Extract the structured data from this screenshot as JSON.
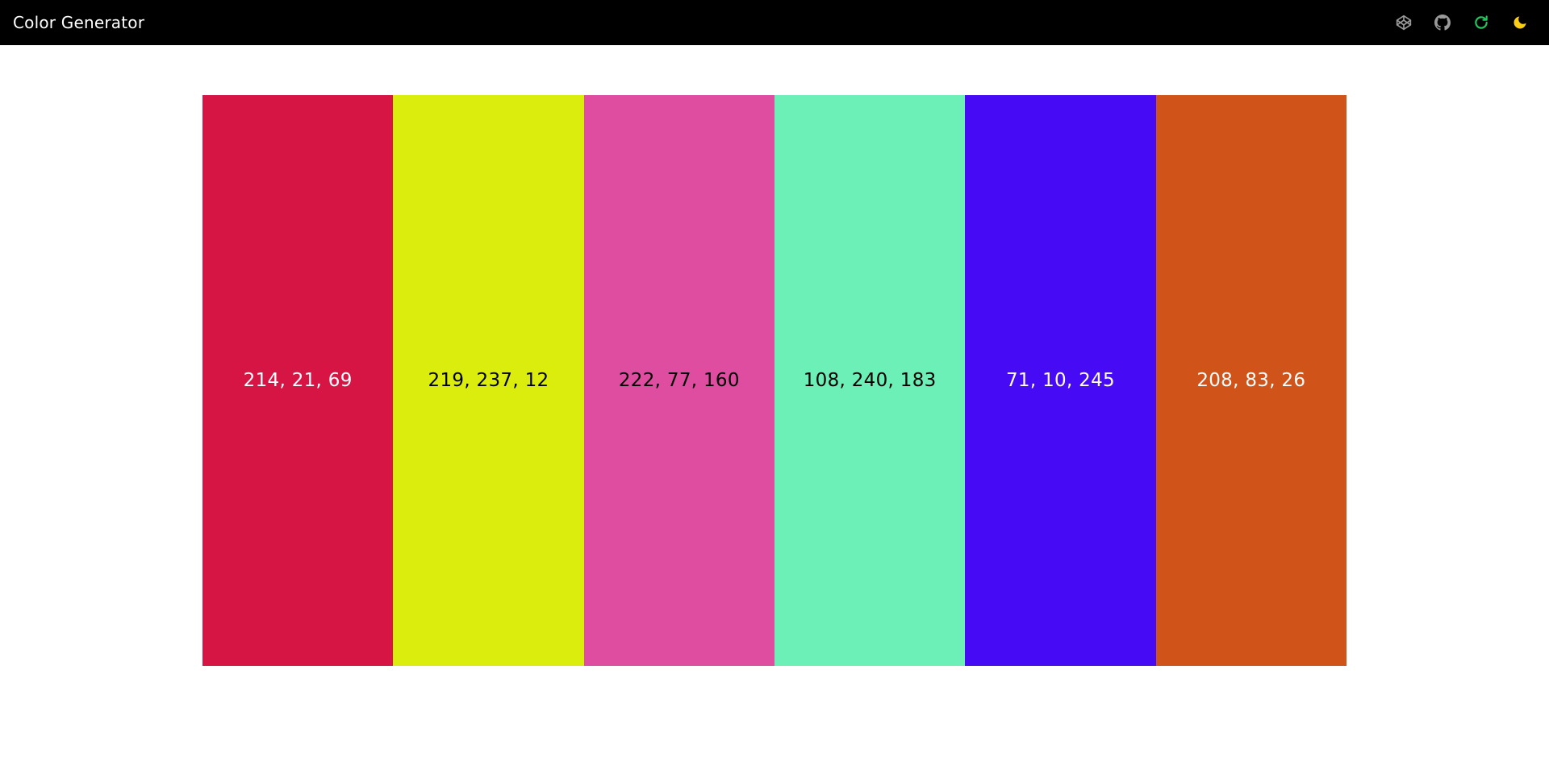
{
  "header": {
    "title": "Color Generator",
    "icons": [
      {
        "name": "codepen-icon",
        "color": "#9a9a9a"
      },
      {
        "name": "github-icon",
        "color": "#9a9a9a"
      },
      {
        "name": "refresh-icon",
        "color": "#22c55e"
      },
      {
        "name": "moon-icon",
        "color": "#facc15"
      }
    ]
  },
  "swatches": [
    {
      "label": "214, 21, 69",
      "color": "#d61545",
      "text_color": "#ffffff"
    },
    {
      "label": "219, 237, 12",
      "color": "#dbed0c",
      "text_color": "#000000"
    },
    {
      "label": "222, 77, 160",
      "color": "#de4da0",
      "text_color": "#000000"
    },
    {
      "label": "108, 240, 183",
      "color": "#6cf0b7",
      "text_color": "#000000"
    },
    {
      "label": "71, 10, 245",
      "color": "#470af5",
      "text_color": "#ffffff"
    },
    {
      "label": "208, 83, 26",
      "color": "#d0531a",
      "text_color": "#ffffff"
    }
  ]
}
